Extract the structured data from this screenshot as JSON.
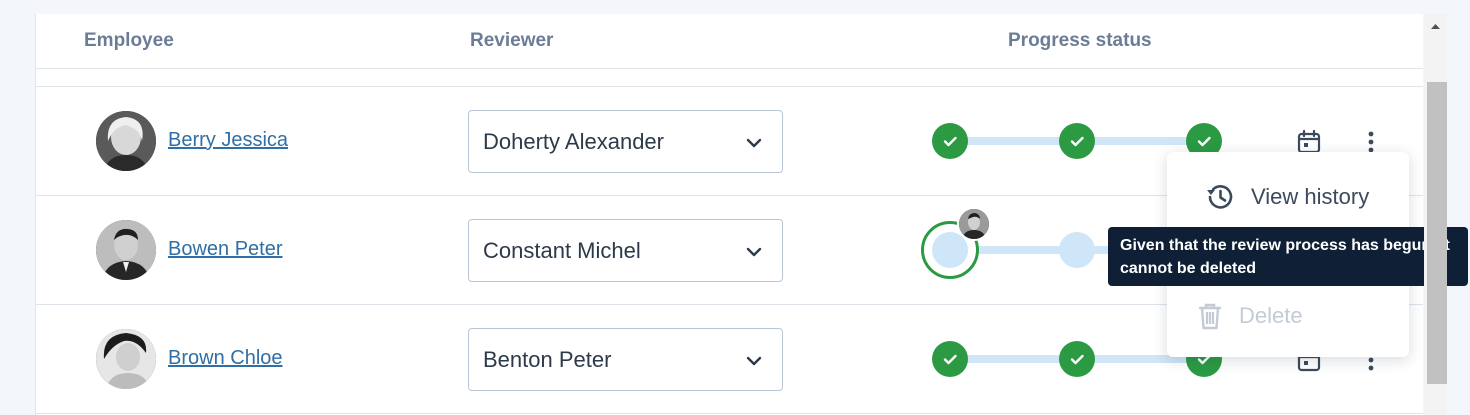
{
  "table": {
    "headers": {
      "employee": "Employee",
      "reviewer": "Reviewer",
      "progress": "Progress status"
    },
    "rows": [
      {
        "employee": "Berry Jessica",
        "reviewer": "Doherty Alexander",
        "progress": "3 of 3 steps complete"
      },
      {
        "employee": "Bowen Peter",
        "reviewer": "Constant Michel",
        "progress": "step 1 in progress"
      },
      {
        "employee": "Brown Chloe",
        "reviewer": "Benton Peter",
        "progress": "3 of 3 steps complete"
      }
    ]
  },
  "menu": {
    "view_history": "View history",
    "delete": "Delete"
  },
  "tooltip": {
    "text": "Given that the review process has begun, it cannot be deleted"
  },
  "colors": {
    "complete": "#2b9a43",
    "pending": "#cfe6f8",
    "link": "#2f6fa5",
    "tooltip_bg": "#0f2036"
  }
}
